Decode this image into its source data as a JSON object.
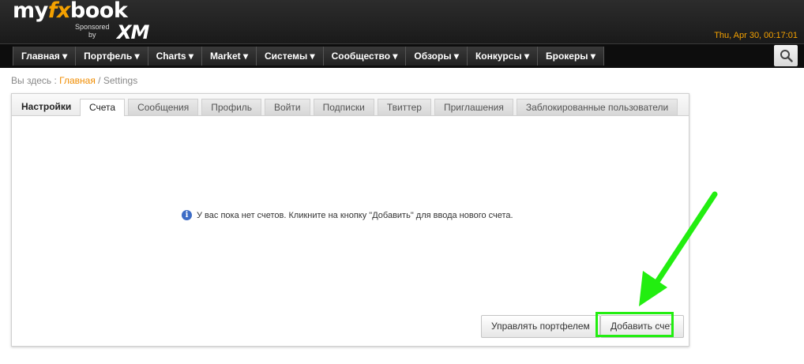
{
  "header": {
    "logo_text_a": "my",
    "logo_text_fx": "fx",
    "logo_text_b": "book",
    "sponsored_line1": "Sponsored",
    "sponsored_line2": "by",
    "sponsor_brand": "XM",
    "datetime": "Thu, Apr 30, 00:17:01"
  },
  "nav": {
    "items": [
      {
        "label": "Главная ▾"
      },
      {
        "label": "Портфель ▾"
      },
      {
        "label": "Charts ▾"
      },
      {
        "label": "Market ▾"
      },
      {
        "label": "Системы ▾"
      },
      {
        "label": "Сообщество ▾"
      },
      {
        "label": "Обзоры ▾"
      },
      {
        "label": "Конкурсы ▾"
      },
      {
        "label": "Брокеры ▾"
      }
    ],
    "search_icon": "search-icon"
  },
  "breadcrumb": {
    "prefix": "Вы здесь : ",
    "home": "Главная",
    "separator": " / ",
    "current": "Settings"
  },
  "settings": {
    "title": "Настройки",
    "tabs": [
      {
        "label": "Счета",
        "active": true
      },
      {
        "label": "Сообщения"
      },
      {
        "label": "Профиль"
      },
      {
        "label": "Войти"
      },
      {
        "label": "Подписки"
      },
      {
        "label": "Твиттер"
      },
      {
        "label": "Приглашения"
      },
      {
        "label": "Заблокированные пользователи"
      }
    ],
    "empty_message": "У вас пока нет счетов. Кликните на кнопку \"Добавить\" для ввода нового счета.",
    "manage_button": "Управлять портфелем",
    "add_button": "Добавить счет"
  },
  "colors": {
    "accent_orange": "#f08c00",
    "highlight_green": "#22ee10"
  }
}
